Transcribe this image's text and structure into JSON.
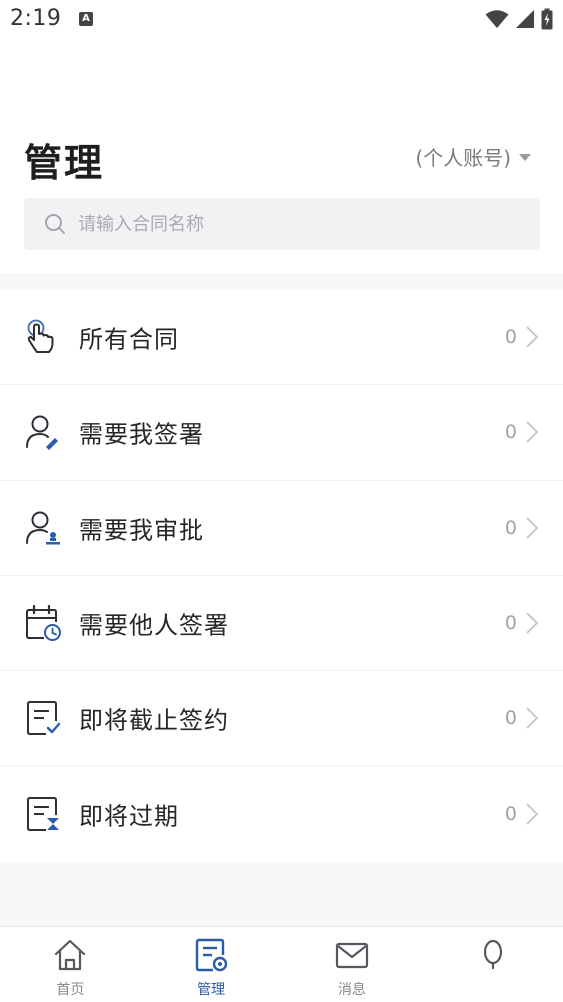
{
  "status_bar": {
    "time": "2:19",
    "notification_icon_letter": "A"
  },
  "header": {
    "title": "管理",
    "account_switch_label": "(个人账号)"
  },
  "search": {
    "placeholder": "请输入合同名称"
  },
  "list": {
    "items": [
      {
        "label": "所有合同",
        "count": "0",
        "icon": "hand-tap-icon"
      },
      {
        "label": "需要我签署",
        "count": "0",
        "icon": "user-pen-icon"
      },
      {
        "label": "需要我审批",
        "count": "0",
        "icon": "user-stamp-icon"
      },
      {
        "label": "需要他人签署",
        "count": "0",
        "icon": "calendar-clock-icon"
      },
      {
        "label": "即将截止签约",
        "count": "0",
        "icon": "document-check-icon"
      },
      {
        "label": "即将过期",
        "count": "0",
        "icon": "document-hourglass-icon"
      }
    ]
  },
  "bottom_nav": {
    "items": [
      {
        "label": "首页",
        "icon": "home-icon",
        "active": false
      },
      {
        "label": "管理",
        "icon": "manage-doc-icon",
        "active": true
      },
      {
        "label": "消息",
        "icon": "mail-icon",
        "active": false
      },
      {
        "label": "",
        "icon": "profile-icon",
        "active": false
      }
    ]
  },
  "colors": {
    "accent": "#2a5cab",
    "icon_dark": "#2b2f36",
    "text_primary": "#262626",
    "text_muted": "#a3a3a3",
    "background": "#f7f7f8"
  }
}
